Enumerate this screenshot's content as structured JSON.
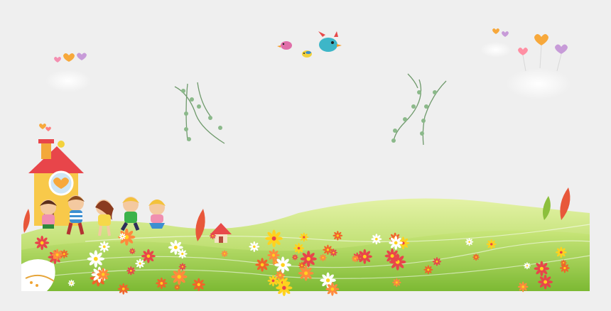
{
  "scene": {
    "background": "#efefef",
    "grass_light": "#d8ec8a",
    "grass_mid": "#a9d24b",
    "grass_dark": "#6fae2c",
    "flower_colors": [
      "#ffffff",
      "#f0642a",
      "#ffd21e",
      "#e8454a",
      "#ff8a3d"
    ],
    "heart_colors": [
      "#f7a83b",
      "#f48fb1",
      "#c79bd8",
      "#ff7f7f"
    ],
    "elements": [
      "cartoon-house",
      "children-group",
      "birds",
      "clouds",
      "hanging-vines",
      "flower-meadow",
      "floating-hearts"
    ]
  }
}
